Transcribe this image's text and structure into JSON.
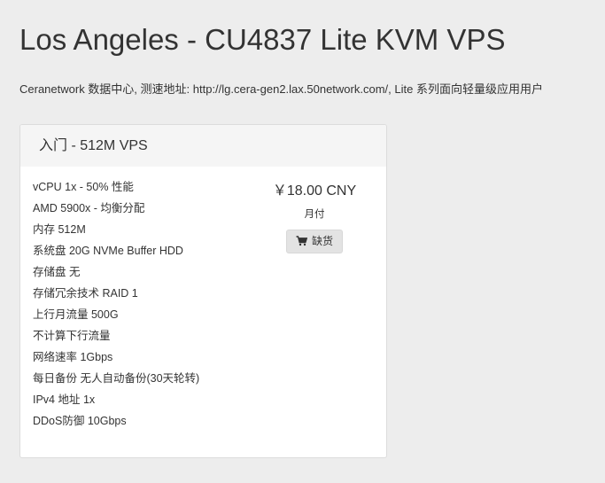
{
  "header": {
    "title": "Los Angeles - CU4837 Lite KVM VPS",
    "subtitle": "Ceranetwork 数据中心, 测速地址: http://lg.cera-gen2.lax.50network.com/, Lite 系列面向轻量级应用用户"
  },
  "product": {
    "name": "入门 - 512M VPS",
    "features": [
      "vCPU 1x - 50% 性能",
      "AMD 5900x - 均衡分配",
      "内存 512M",
      "系统盘 20G NVMe Buffer HDD",
      "存储盘 无",
      "存储冗余技术 RAID 1",
      "上行月流量 500G",
      "不计算下行流量",
      "网络速率 1Gbps",
      "每日备份 无人自动备份(30天轮转)",
      "IPv4 地址 1x",
      "DDoS防御 10Gbps"
    ],
    "price": "￥18.00 CNY",
    "billing_cycle": "月付",
    "order_button": {
      "label": "缺货",
      "icon": "shopping-cart-icon"
    }
  }
}
